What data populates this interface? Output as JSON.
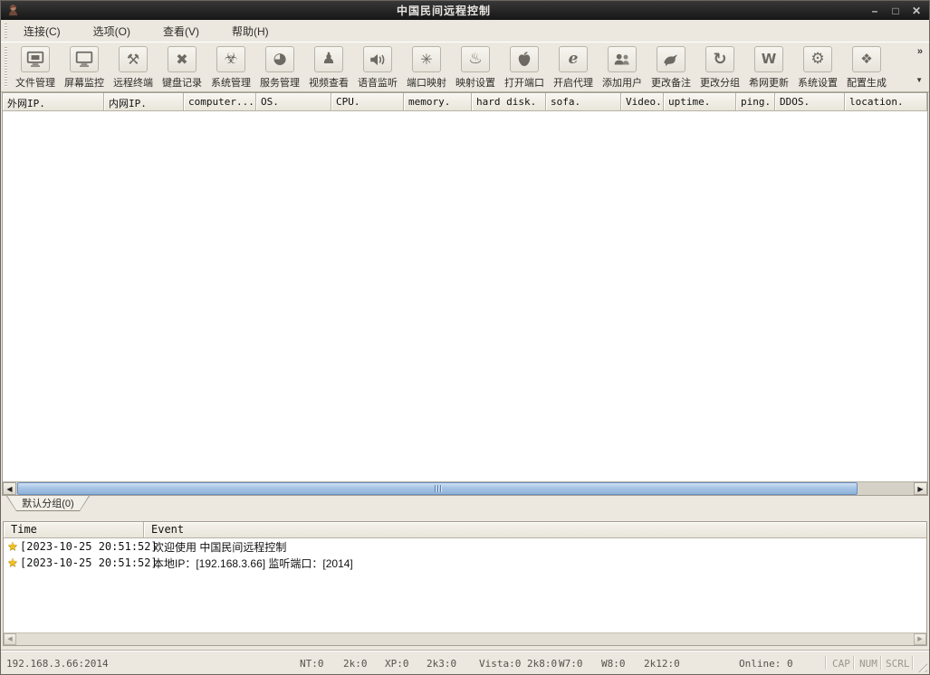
{
  "window": {
    "title": "中国民间远程控制",
    "controls": {
      "minimize": "–",
      "maximize": "□",
      "close": "✕"
    }
  },
  "menu": {
    "items": [
      {
        "label": "连接(C)"
      },
      {
        "label": "选项(O)"
      },
      {
        "label": "查看(V)"
      },
      {
        "label": "帮助(H)"
      }
    ]
  },
  "toolbar": {
    "overflow_more": "»",
    "overflow_dropdown": "▼",
    "buttons": [
      {
        "label": "文件管理",
        "icon": "file-manager-icon"
      },
      {
        "label": "屏幕监控",
        "icon": "screen-monitor-icon"
      },
      {
        "label": "远程终端",
        "icon": "remote-terminal-icon"
      },
      {
        "label": "键盘记录",
        "icon": "keylogger-icon"
      },
      {
        "label": "系统管理",
        "icon": "system-management-icon"
      },
      {
        "label": "服务管理",
        "icon": "service-management-icon"
      },
      {
        "label": "视频查看",
        "icon": "video-view-icon"
      },
      {
        "label": "语音监听",
        "icon": "voice-listen-icon"
      },
      {
        "label": "端口映射",
        "icon": "port-mapping-icon"
      },
      {
        "label": "映射设置",
        "icon": "mapping-settings-icon"
      },
      {
        "label": "打开端口",
        "icon": "open-port-icon"
      },
      {
        "label": "开启代理",
        "icon": "open-proxy-icon"
      },
      {
        "label": "添加用户",
        "icon": "add-user-icon"
      },
      {
        "label": "更改备注",
        "icon": "change-note-icon"
      },
      {
        "label": "更改分组",
        "icon": "change-group-icon"
      },
      {
        "label": "希网更新",
        "icon": "update-icon"
      },
      {
        "label": "系统设置",
        "icon": "system-settings-icon"
      },
      {
        "label": "配置生成",
        "icon": "config-generate-icon"
      }
    ]
  },
  "client_list": {
    "columns": [
      {
        "label": "外网IP."
      },
      {
        "label": "内网IP."
      },
      {
        "label": "computer..."
      },
      {
        "label": "OS."
      },
      {
        "label": "CPU."
      },
      {
        "label": "memory."
      },
      {
        "label": "hard disk."
      },
      {
        "label": "sofa."
      },
      {
        "label": "Video."
      },
      {
        "label": "uptime."
      },
      {
        "label": "ping."
      },
      {
        "label": "DDOS."
      },
      {
        "label": "location."
      }
    ],
    "rows": []
  },
  "group_tab": {
    "label": "默认分组(0)"
  },
  "event_log": {
    "columns": {
      "time": "Time",
      "event": "Event"
    },
    "rows": [
      {
        "time": "[2023-10-25 20:51:52]",
        "event": "欢迎使用 中国民间远程控制"
      },
      {
        "time": "[2023-10-25 20:51:52]",
        "event": "本地IP：[192.168.3.66] 监听端口：[2014]"
      }
    ]
  },
  "statusbar": {
    "address": "192.168.3.66:2014",
    "os_counts": [
      {
        "label": "NT:0"
      },
      {
        "label": "2k:0"
      },
      {
        "label": "XP:0"
      },
      {
        "label": "2k3:0"
      },
      {
        "label": "Vista:0 2k8:0"
      },
      {
        "label": "W7:0"
      },
      {
        "label": "W8:0"
      },
      {
        "label": "2k12:0"
      }
    ],
    "online": "Online: 0",
    "lock_keys": [
      {
        "label": "CAP"
      },
      {
        "label": "NUM"
      },
      {
        "label": "SCRL"
      }
    ]
  },
  "colors": {
    "titlebar_bg": "#1e1e1e",
    "chrome_bg": "#ece8e0",
    "scrollbar_thumb": "#a6c4e6",
    "star": "#f2c11e"
  }
}
